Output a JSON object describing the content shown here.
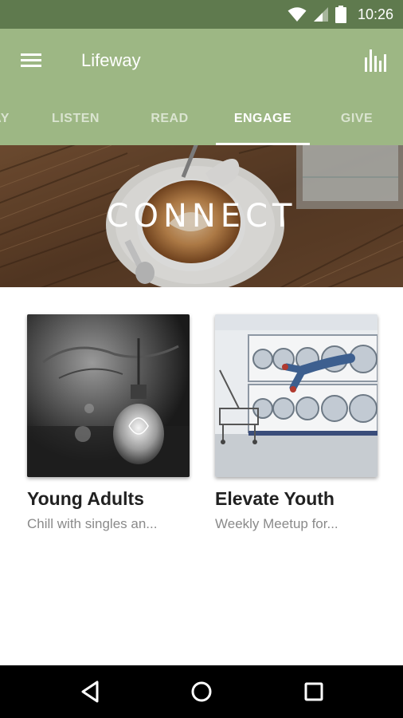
{
  "status_bar": {
    "time": "10:26",
    "icons": [
      "wifi-icon",
      "cell-signal-icon",
      "battery-icon"
    ]
  },
  "app_bar": {
    "title": "Lifeway",
    "menu_icon": "menu-icon",
    "action_icon": "bar-chart-icon",
    "background_color": "#9db784"
  },
  "tabs": [
    {
      "label": "AY",
      "active": false
    },
    {
      "label": "LISTEN",
      "active": false
    },
    {
      "label": "READ",
      "active": false
    },
    {
      "label": "ENGAGE",
      "active": true
    },
    {
      "label": "GIVE",
      "active": false
    }
  ],
  "hero": {
    "title": "CONNECT",
    "image": "coffee-cup-on-wooden-table"
  },
  "cards": [
    {
      "title": "Young Adults",
      "subtitle": "Chill with singles an...",
      "image": "hanging-light-bulb-black-and-white"
    },
    {
      "title": "Elevate Youth",
      "subtitle": "Weekly Meetup for...",
      "image": "person-diving-into-laundromat-dryer"
    }
  ],
  "nav_bar": {
    "buttons": [
      "back-icon",
      "home-icon",
      "recents-icon"
    ]
  }
}
